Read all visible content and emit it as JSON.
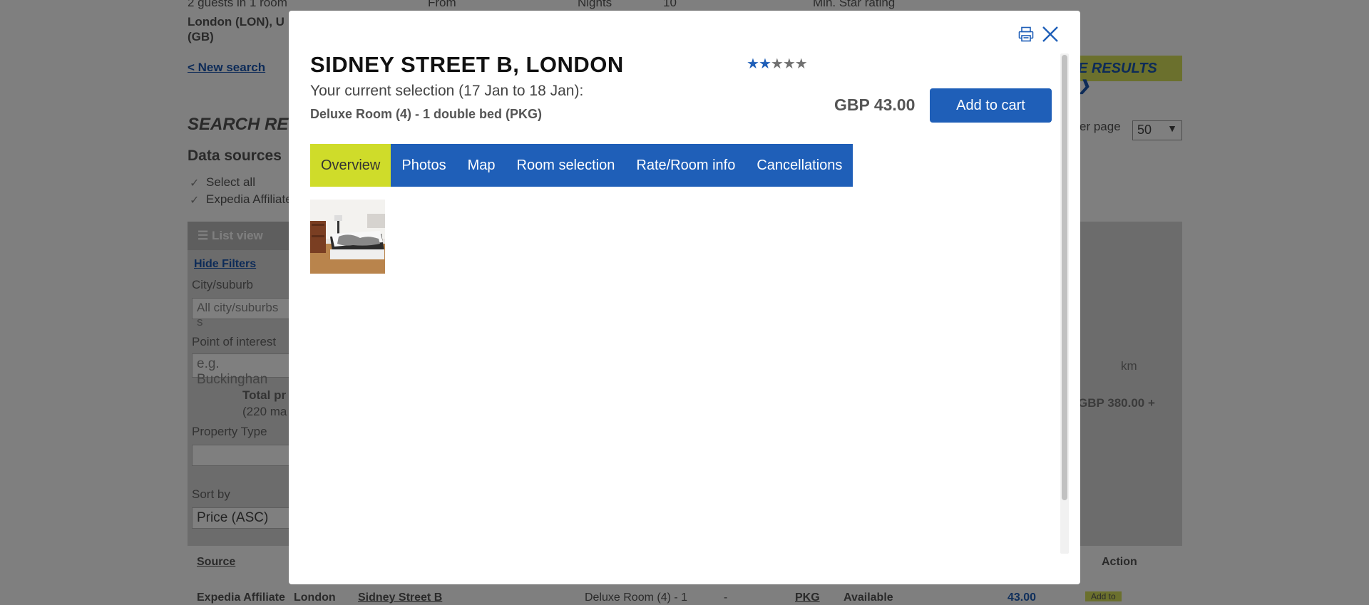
{
  "background": {
    "guests": "2 guests in 1 room",
    "from_label": "From",
    "nights_label": "Nights",
    "nights_value": "10",
    "min_star_label": "Min. Star rating",
    "destination": "London (LON), U",
    "destination_country": "(GB)",
    "new_search": "< New search",
    "search_results_title": "SEARCH RE",
    "data_sources": "Data sources",
    "select_all": "Select all",
    "expedia_affiliate": "Expedia Affiliate",
    "list_view": "List view",
    "hide_filters": "Hide Filters",
    "city_label": "City/suburb",
    "city_value": "All city/suburbs s",
    "poi_label": "Point of interest",
    "poi_placeholder": "e.g. Buckinghan",
    "total_price_label": "Total pr",
    "total_price_sub": "(220 ma",
    "property_type_label": "Property Type",
    "sort_by_label": "Sort by",
    "sort_by_value": "Price (ASC)",
    "results_button": "E RESULTS",
    "per_page_label": "er page",
    "per_page_value": "50",
    "km_label": "km",
    "price_range_max": "GBP 380.00 +",
    "table_source_header": "Source",
    "table_action_header": "Action",
    "row_source": "Expedia Affiliate",
    "row_city": "London",
    "row_hotel": "Sidney Street B",
    "row_room": "Deluxe Room (4) - 1",
    "row_dash": "-",
    "row_pkg": "PKG",
    "row_status": "Available",
    "row_price": "43.00",
    "row_add": "Add to"
  },
  "modal": {
    "hotel_name": "SIDNEY STREET B, LONDON",
    "star_rating": 2,
    "star_max": 5,
    "selection_text": "Your current selection (17 Jan to 18 Jan):",
    "room_text": "Deluxe Room (4) - 1 double bed (PKG)",
    "price": "GBP 43.00",
    "add_to_cart": "Add to cart",
    "tabs": [
      {
        "label": "Overview",
        "active": true
      },
      {
        "label": "Photos",
        "active": false
      },
      {
        "label": "Map",
        "active": false
      },
      {
        "label": "Room selection",
        "active": false
      },
      {
        "label": "Rate/Room info",
        "active": false
      },
      {
        "label": "Cancellations",
        "active": false
      }
    ],
    "icons": [
      "print-icon",
      "close-icon"
    ]
  },
  "colors": {
    "accent_blue": "#1f5fb8",
    "active_tab": "#cfdc2a",
    "overlay": "rgba(0,0,0,0.5)"
  }
}
